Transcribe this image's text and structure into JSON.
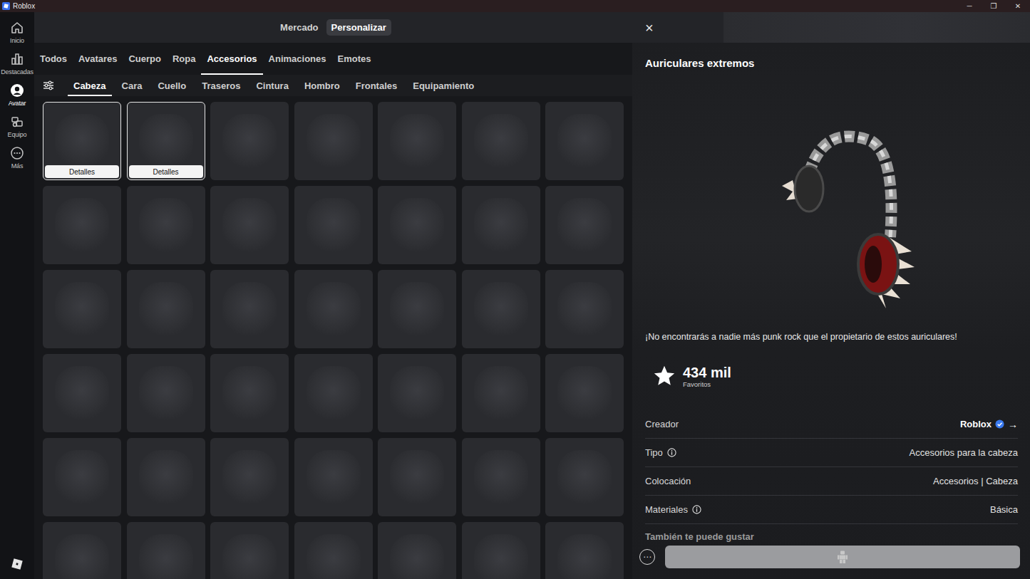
{
  "window": {
    "title": "Roblox",
    "controls": [
      "─",
      "❐",
      "✕"
    ]
  },
  "sidebar": {
    "items": [
      {
        "label": "Inicio",
        "selected": false
      },
      {
        "label": "Destacadas",
        "selected": false
      },
      {
        "label": "Avatar",
        "selected": true
      },
      {
        "label": "Equipo",
        "selected": false
      },
      {
        "label": "Más",
        "selected": false
      }
    ]
  },
  "modes": [
    {
      "label": "Mercado",
      "selected": false
    },
    {
      "label": "Personalizar",
      "selected": true
    }
  ],
  "close": "×",
  "categories": [
    {
      "label": "Todos",
      "selected": false
    },
    {
      "label": "Avatares",
      "selected": false
    },
    {
      "label": "Cuerpo",
      "selected": false
    },
    {
      "label": "Ropa",
      "selected": false
    },
    {
      "label": "Accesorios",
      "selected": true
    },
    {
      "label": "Animaciones",
      "selected": false
    },
    {
      "label": "Emotes",
      "selected": false
    }
  ],
  "subcategories": [
    {
      "label": "Cabeza",
      "selected": true
    },
    {
      "label": "Cara",
      "selected": false
    },
    {
      "label": "Cuello",
      "selected": false
    },
    {
      "label": "Traseros",
      "selected": false
    },
    {
      "label": "Cintura",
      "selected": false
    },
    {
      "label": "Hombro",
      "selected": false
    },
    {
      "label": "Frontales",
      "selected": false
    },
    {
      "label": "Equipamiento",
      "selected": false
    }
  ],
  "items": [
    {
      "selected": true,
      "button": "Detalles"
    },
    {
      "selected": true,
      "button": "Detalles"
    },
    {
      "selected": false
    },
    {
      "selected": false
    },
    {
      "selected": false
    },
    {
      "selected": false
    },
    {
      "selected": false
    },
    {
      "selected": false
    },
    {
      "selected": false
    },
    {
      "selected": false
    },
    {
      "selected": false
    },
    {
      "selected": false
    },
    {
      "selected": false
    },
    {
      "selected": false
    },
    {
      "selected": false
    },
    {
      "selected": false
    },
    {
      "selected": false
    },
    {
      "selected": false
    },
    {
      "selected": false
    },
    {
      "selected": false
    },
    {
      "selected": false
    },
    {
      "selected": false
    },
    {
      "selected": false
    },
    {
      "selected": false
    },
    {
      "selected": false
    },
    {
      "selected": false
    },
    {
      "selected": false
    },
    {
      "selected": false
    },
    {
      "selected": false
    },
    {
      "selected": false
    },
    {
      "selected": false
    },
    {
      "selected": false
    },
    {
      "selected": false
    },
    {
      "selected": false
    },
    {
      "selected": false
    },
    {
      "selected": false
    },
    {
      "selected": false
    },
    {
      "selected": false
    },
    {
      "selected": false
    },
    {
      "selected": false
    },
    {
      "selected": false
    },
    {
      "selected": false
    }
  ],
  "detail": {
    "title": "Auriculares extremos",
    "description": "¡No encontrarás a nadie más punk rock que el propietario de estos auriculares!",
    "favorites": {
      "count": "434 mil",
      "label": "Favoritos"
    },
    "properties": [
      {
        "label": "Creador",
        "value": "Roblox",
        "info": false,
        "verified": true,
        "link": "→"
      },
      {
        "label": "Tipo",
        "value": "Accesorios para la cabeza",
        "info": true,
        "verified": false
      },
      {
        "label": "Colocación",
        "value": "Accesorios | Cabeza",
        "info": false,
        "verified": false
      },
      {
        "label": "Materiales",
        "value": "Básica",
        "info": true,
        "verified": false
      }
    ],
    "more_heading": "También te puede gustar",
    "action_more": "⋯"
  }
}
